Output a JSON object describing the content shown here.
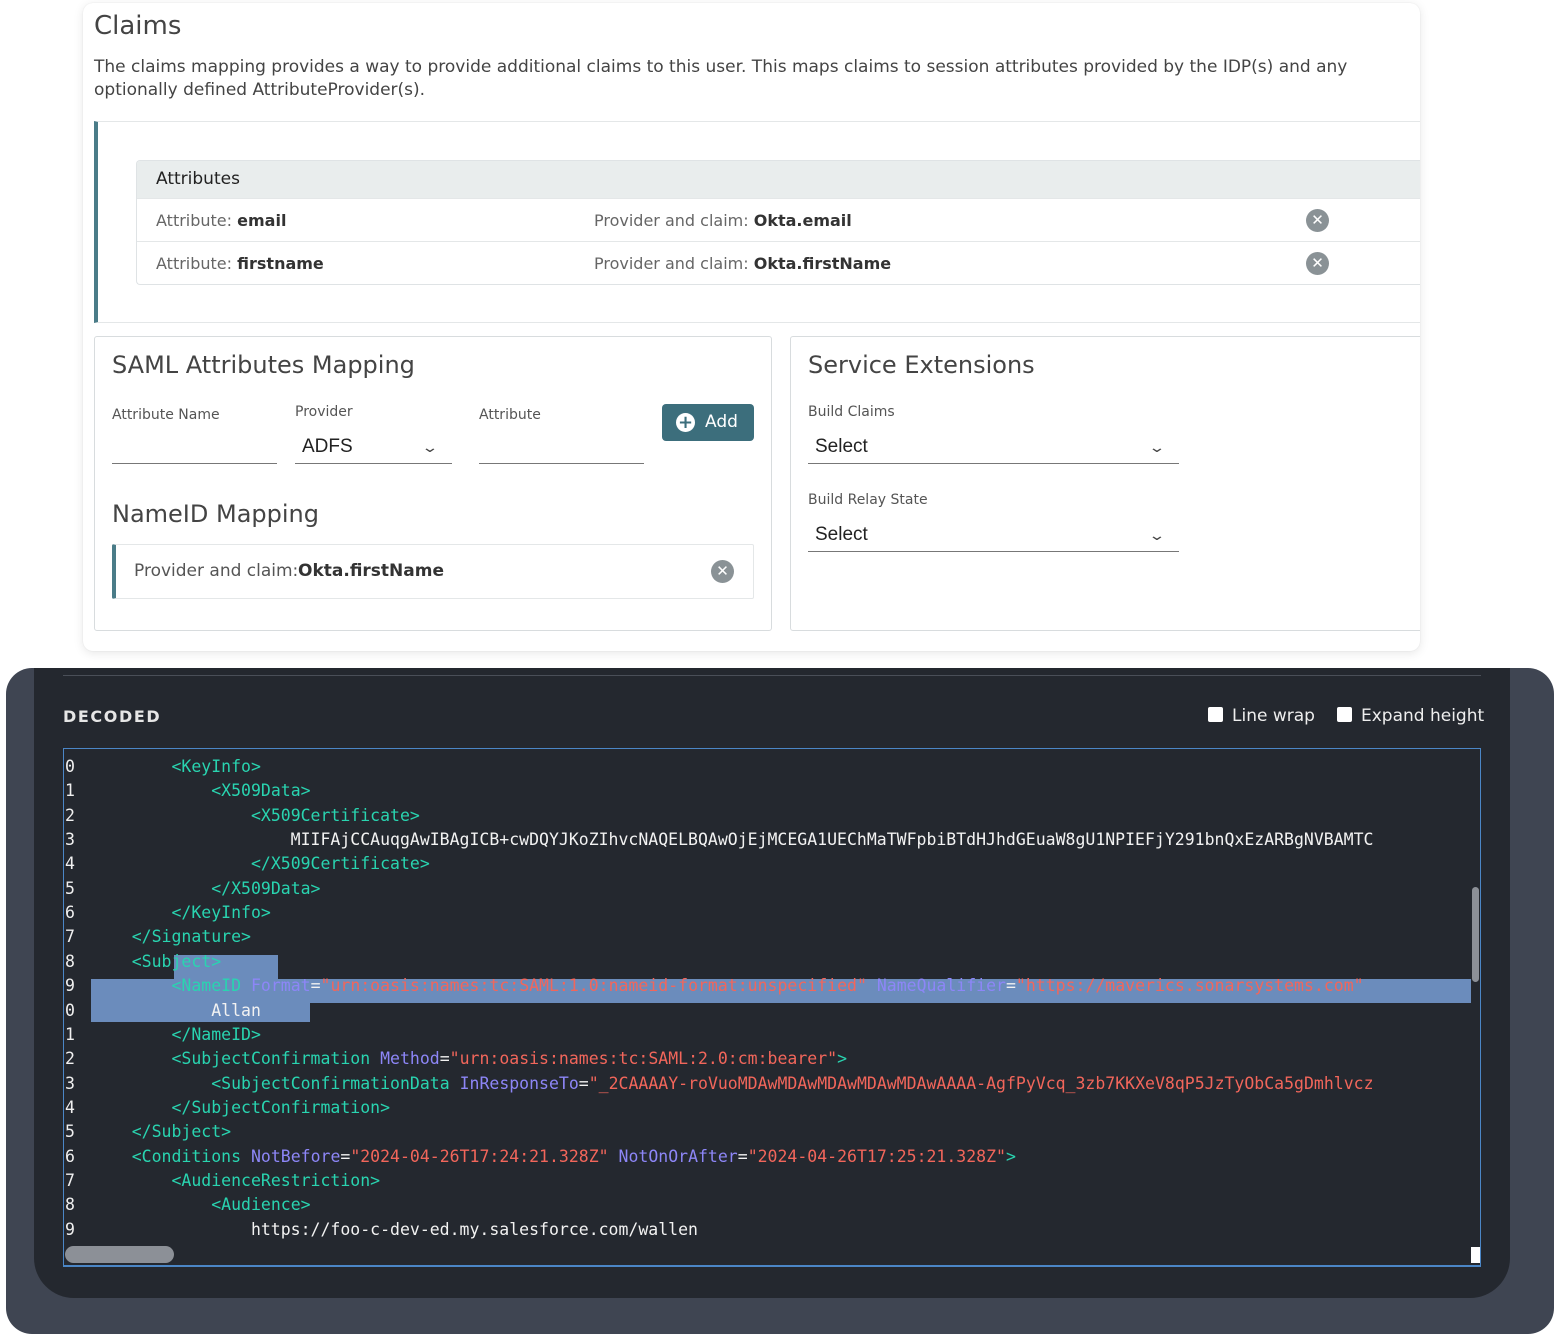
{
  "claims": {
    "title": "Claims",
    "description": "The claims mapping provides a way to provide additional claims to this user. This maps claims to session attributes provided by the IDP(s) and any optionally defined AttributeProvider(s).",
    "attributes_header": "Attributes",
    "rows": [
      {
        "attr_prefix": "Attribute:",
        "attr_value": "email",
        "claim_prefix": "Provider and claim:",
        "claim_value": "Okta.email"
      },
      {
        "attr_prefix": "Attribute:",
        "attr_value": "firstname",
        "claim_prefix": "Provider and claim:",
        "claim_value": "Okta.firstName"
      }
    ]
  },
  "saml_mapping": {
    "title": "SAML Attributes Mapping",
    "attribute_name_label": "Attribute Name",
    "provider_label": "Provider",
    "provider_value": "ADFS",
    "attribute_label": "Attribute",
    "add_label": "Add"
  },
  "nameid_mapping": {
    "title": "NameID Mapping",
    "key": "Provider and claim:",
    "value": "Okta.firstName"
  },
  "service_extensions": {
    "title": "Service Extensions",
    "build_claims_label": "Build Claims",
    "build_claims_value": "Select",
    "build_relay_label": "Build Relay State",
    "build_relay_value": "Select"
  },
  "decoded": {
    "title": "DECODED",
    "line_wrap_label": "Line wrap",
    "expand_height_label": "Expand height",
    "line_numbers": [
      "0",
      "1",
      "2",
      "3",
      "4",
      "5",
      "6",
      "7",
      "8",
      "9",
      "0",
      "1",
      "2",
      "3",
      "4",
      "5",
      "6",
      "7",
      "8",
      "9"
    ],
    "lines": [
      [
        {
          "c": "tx",
          "t": "        "
        },
        {
          "c": "tg",
          "t": "<KeyInfo>"
        }
      ],
      [
        {
          "c": "tx",
          "t": "            "
        },
        {
          "c": "tg",
          "t": "<X509Data>"
        }
      ],
      [
        {
          "c": "tx",
          "t": "                "
        },
        {
          "c": "tg",
          "t": "<X509Certificate>"
        }
      ],
      [
        {
          "c": "tx",
          "t": "                    MIIFAjCCAuqgAwIBAgICB+cwDQYJKoZIhvcNAQELBQAwOjEjMCEGA1UEChMaTWFpbiBTdHJhdGEuaW8gU1NPIEFjY291bnQxEzARBgNVBAMTC"
        }
      ],
      [
        {
          "c": "tx",
          "t": "                "
        },
        {
          "c": "tg",
          "t": "</X509Certificate>"
        }
      ],
      [
        {
          "c": "tx",
          "t": "            "
        },
        {
          "c": "tg",
          "t": "</X509Data>"
        }
      ],
      [
        {
          "c": "tx",
          "t": "        "
        },
        {
          "c": "tg",
          "t": "</KeyInfo>"
        }
      ],
      [
        {
          "c": "tx",
          "t": "    "
        },
        {
          "c": "tg",
          "t": "</Signature>"
        }
      ],
      [
        {
          "c": "tx",
          "t": "    "
        },
        {
          "c": "tg",
          "t": "<Subject>"
        }
      ],
      [
        {
          "c": "tx",
          "t": "        "
        },
        {
          "c": "tg",
          "t": "<NameID "
        },
        {
          "c": "at",
          "t": "Format"
        },
        {
          "c": "tx",
          "t": "="
        },
        {
          "c": "st",
          "t": "\"urn:oasis:names:tc:SAML:1.0:nameid-format:unspecified\""
        },
        {
          "c": "tx",
          "t": " "
        },
        {
          "c": "at",
          "t": "NameQualifier"
        },
        {
          "c": "tx",
          "t": "="
        },
        {
          "c": "st",
          "t": "\"https://maverics.sonarsystems.com\""
        }
      ],
      [
        {
          "c": "tx",
          "t": "            Allan"
        }
      ],
      [
        {
          "c": "tx",
          "t": "        "
        },
        {
          "c": "tg",
          "t": "</NameID>"
        }
      ],
      [
        {
          "c": "tx",
          "t": "        "
        },
        {
          "c": "tg",
          "t": "<SubjectConfirmation "
        },
        {
          "c": "at",
          "t": "Method"
        },
        {
          "c": "tx",
          "t": "="
        },
        {
          "c": "st",
          "t": "\"urn:oasis:names:tc:SAML:2.0:cm:bearer\""
        },
        {
          "c": "tg",
          "t": ">"
        }
      ],
      [
        {
          "c": "tx",
          "t": "            "
        },
        {
          "c": "tg",
          "t": "<SubjectConfirmationData "
        },
        {
          "c": "at",
          "t": "InResponseTo"
        },
        {
          "c": "tx",
          "t": "="
        },
        {
          "c": "st",
          "t": "\"_2CAAAAY-roVuoMDAwMDAwMDAwMDAwMDAwAAAA-AgfPyVcq_3zb7KKXeV8qP5JzTyObCa5gDmhlvcz"
        }
      ],
      [
        {
          "c": "tx",
          "t": "        "
        },
        {
          "c": "tg",
          "t": "</SubjectConfirmation>"
        }
      ],
      [
        {
          "c": "tx",
          "t": "    "
        },
        {
          "c": "tg",
          "t": "</Subject>"
        }
      ],
      [
        {
          "c": "tx",
          "t": "    "
        },
        {
          "c": "tg",
          "t": "<Conditions "
        },
        {
          "c": "at",
          "t": "NotBefore"
        },
        {
          "c": "tx",
          "t": "="
        },
        {
          "c": "st",
          "t": "\"2024-04-26T17:24:21.328Z\""
        },
        {
          "c": "tx",
          "t": " "
        },
        {
          "c": "at",
          "t": "NotOnOrAfter"
        },
        {
          "c": "tx",
          "t": "="
        },
        {
          "c": "st",
          "t": "\"2024-04-26T17:25:21.328Z\""
        },
        {
          "c": "tg",
          "t": ">"
        }
      ],
      [
        {
          "c": "tx",
          "t": "        "
        },
        {
          "c": "tg",
          "t": "<AudienceRestriction>"
        }
      ],
      [
        {
          "c": "tx",
          "t": "            "
        },
        {
          "c": "tg",
          "t": "<Audience>"
        }
      ],
      [
        {
          "c": "tx",
          "t": "                https://foo-c-dev-ed.my.salesforce.com/wallen"
        }
      ]
    ]
  },
  "colors": {
    "accent": "#3c6e7c",
    "tag": "#29d4b0",
    "attr_name": "#8d86f7",
    "string": "#f2665b",
    "selection": "#6b8cbc"
  }
}
